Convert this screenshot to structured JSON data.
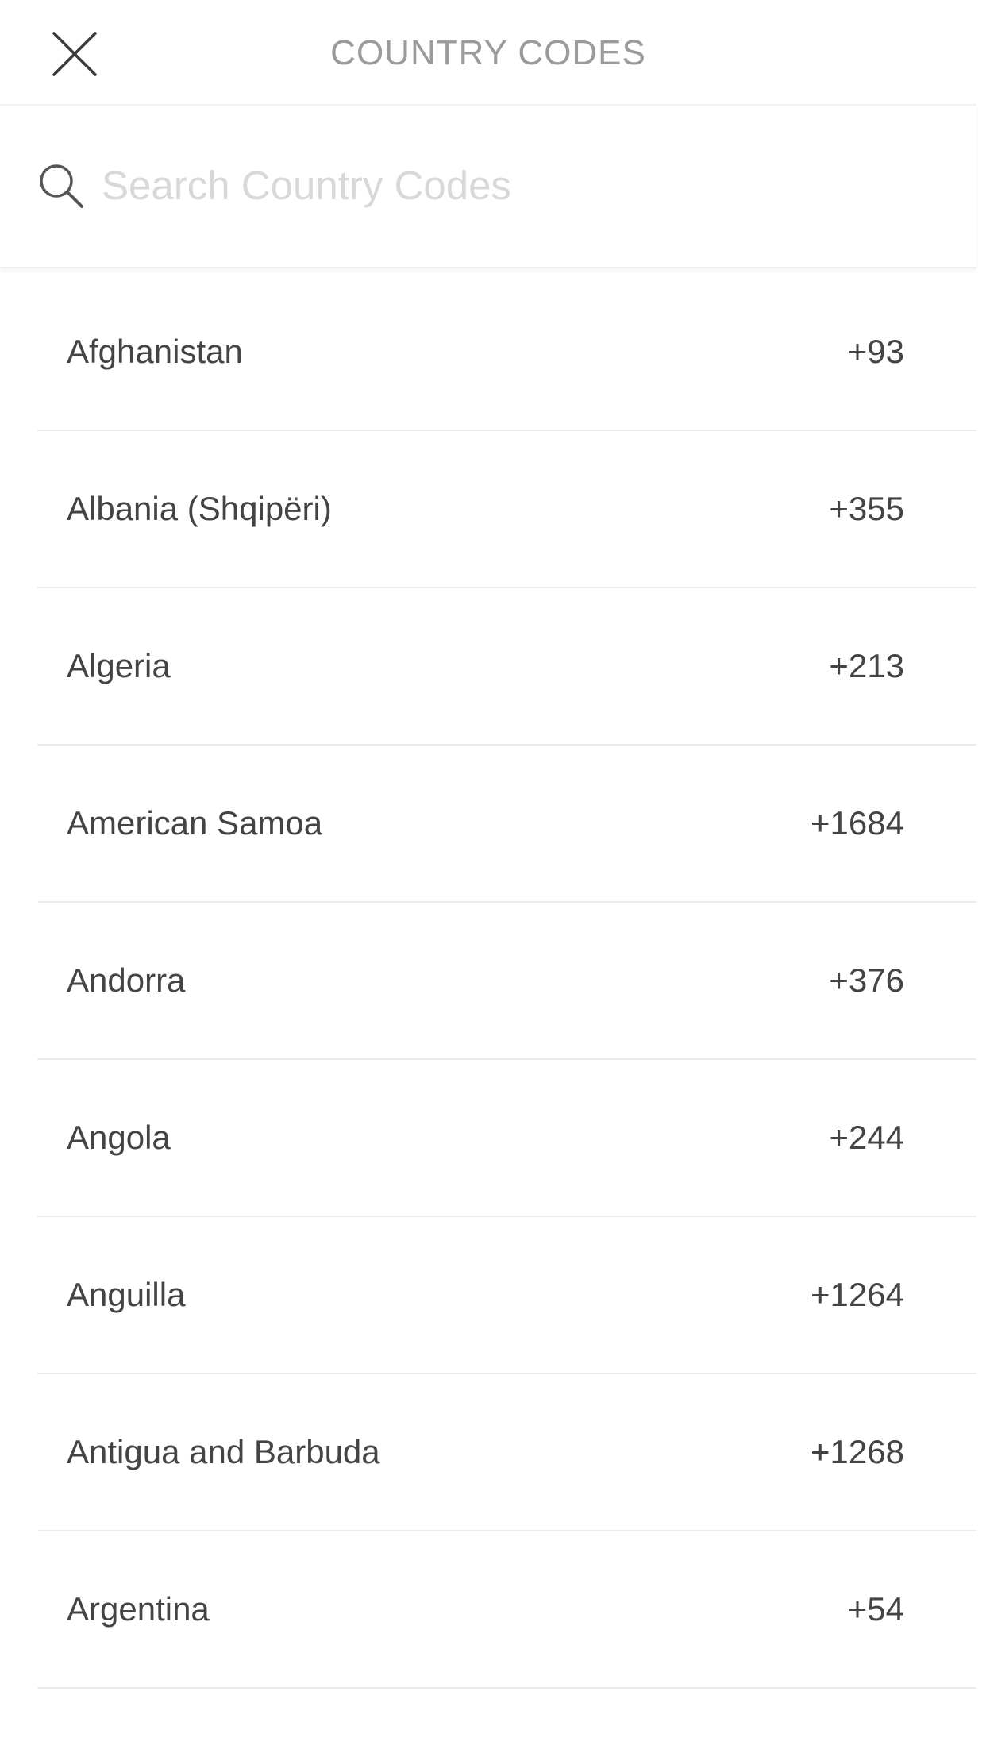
{
  "header": {
    "title": "COUNTRY CODES",
    "close_icon": "close-icon"
  },
  "search": {
    "placeholder": "Search Country Codes",
    "value": "",
    "icon": "search-icon"
  },
  "countries": [
    {
      "name": "Afghanistan",
      "code": "+93"
    },
    {
      "name": "Albania (Shqipëri)",
      "code": "+355"
    },
    {
      "name": "Algeria",
      "code": "+213"
    },
    {
      "name": "American Samoa",
      "code": "+1684"
    },
    {
      "name": "Andorra",
      "code": "+376"
    },
    {
      "name": "Angola",
      "code": "+244"
    },
    {
      "name": "Anguilla",
      "code": "+1264"
    },
    {
      "name": "Antigua and Barbuda",
      "code": "+1268"
    },
    {
      "name": "Argentina",
      "code": "+54"
    }
  ],
  "colors": {
    "title": "#9b9b9b",
    "text": "#444444",
    "placeholder": "#d8d8d8",
    "divider": "#ececec"
  }
}
